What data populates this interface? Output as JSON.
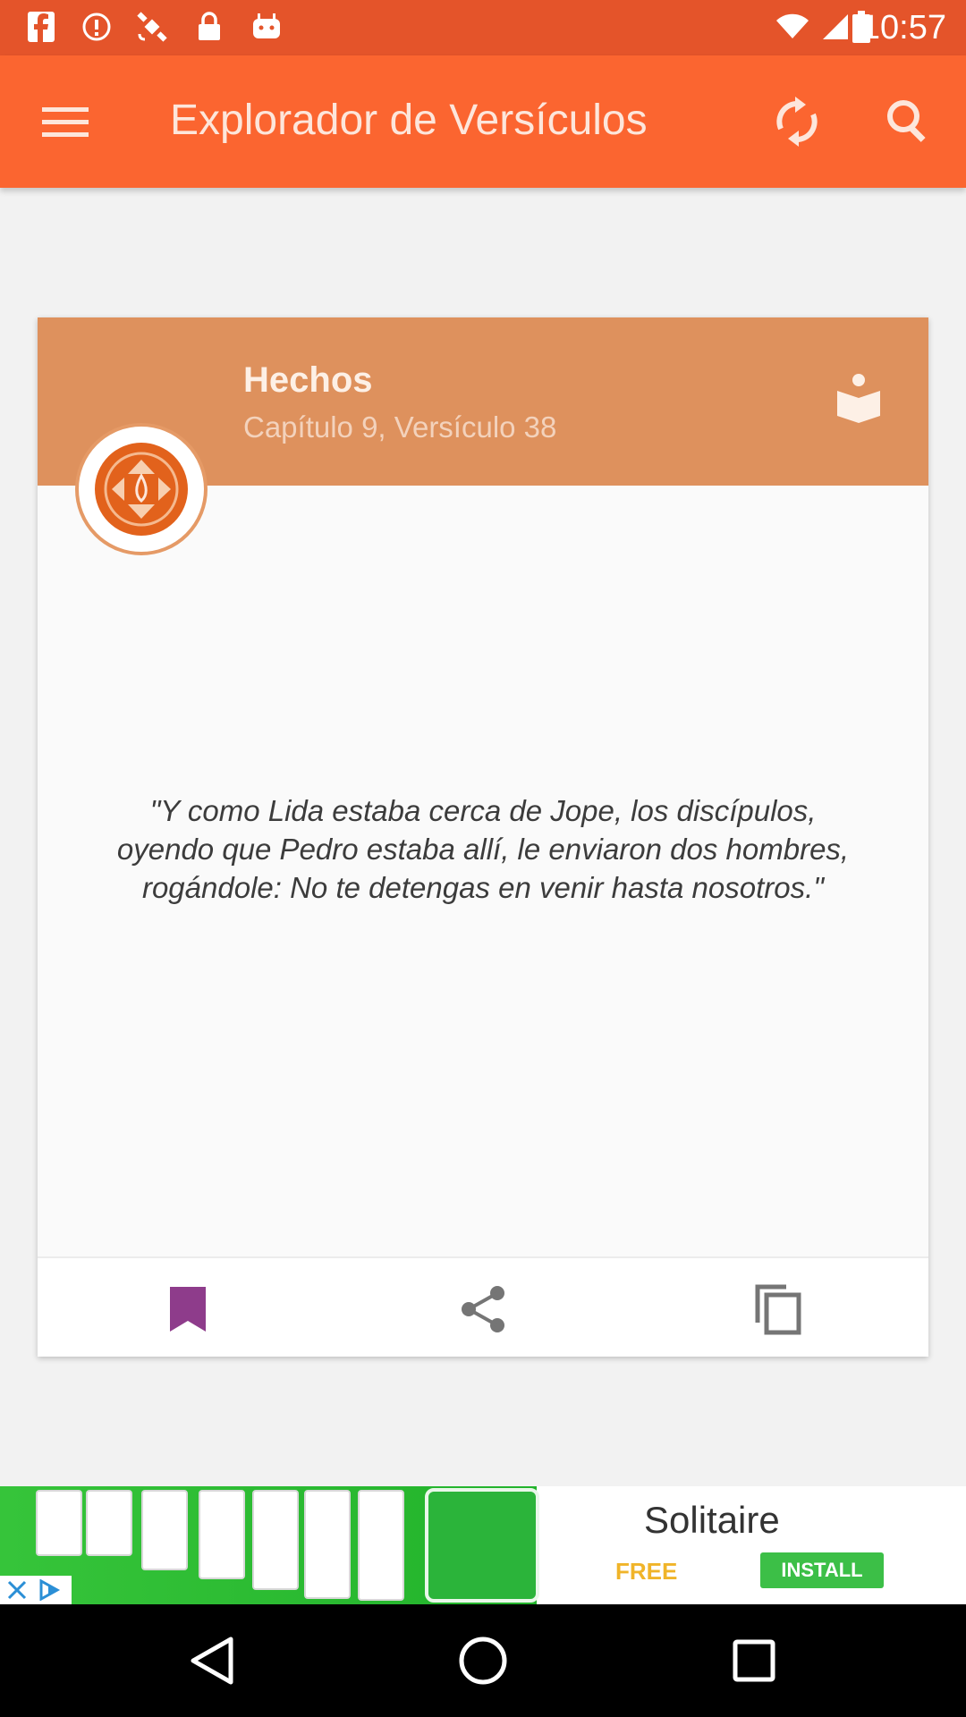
{
  "status_bar": {
    "time": "10:57",
    "left_icons": [
      "facebook-icon",
      "alert-icon",
      "satellite-icon",
      "lock-icon",
      "android-icon"
    ],
    "right_icons": [
      "signal-icon",
      "wifi-icon",
      "battery-icon"
    ]
  },
  "app_bar": {
    "title": "Explorador de Versículos",
    "background": "#fb6530",
    "icons": [
      "menu-icon",
      "refresh-icon",
      "search-icon"
    ]
  },
  "card": {
    "book": "Hechos",
    "chapter_info": "Capítulo 9, Versículo 38",
    "header_color": "#de915d",
    "verse": "\"Y como Lida estaba cerca de Jope, los discípulos, oyendo que Pedro estaba allí, le enviaron dos hombres, rogándole: No te detengas en venir hasta nosotros.\"",
    "actions": [
      "bookmark-icon",
      "share-icon",
      "copy-icon"
    ],
    "bookmark_color": "#8e3c8b"
  },
  "ad": {
    "title": "Solitaire",
    "free_label": "FREE",
    "install_label": "INSTALL"
  },
  "nav_bar": {
    "buttons": [
      "back-icon",
      "home-icon",
      "recents-icon"
    ]
  }
}
